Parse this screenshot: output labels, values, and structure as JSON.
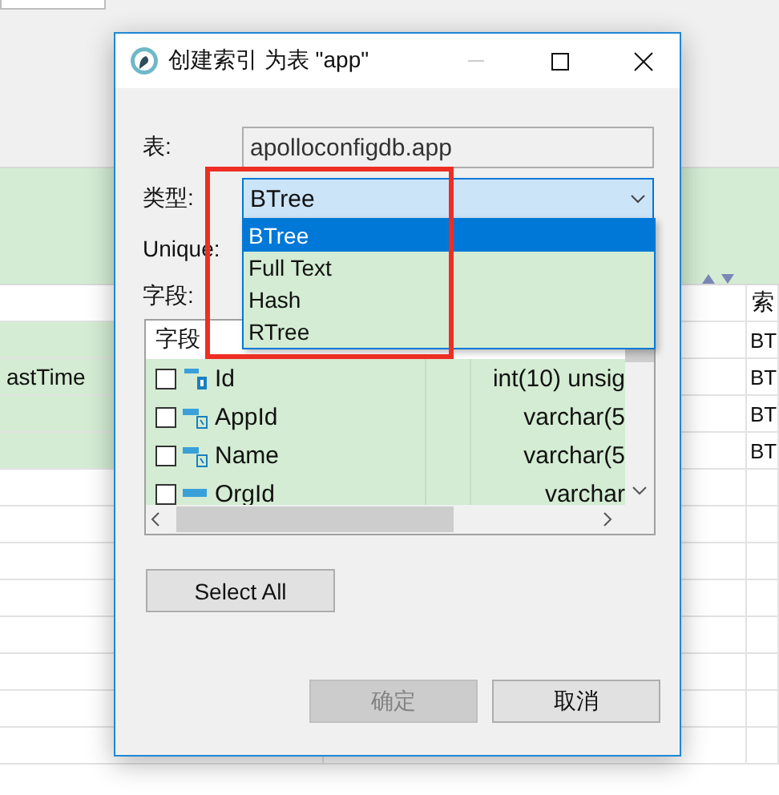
{
  "background_table": {
    "column_3_header": "索",
    "rows": [
      {
        "column_3": "BT"
      },
      {
        "column_1": "astTime",
        "column_3": "BT"
      },
      {
        "column_3": "BT"
      },
      {
        "column_3": "BT"
      }
    ]
  },
  "dialog": {
    "title": "创建索引 为表 \"app\"",
    "table_label": "表:",
    "table_value": "apolloconfigdb.app",
    "type_label": "类型:",
    "type_value": "BTree",
    "type_options": [
      {
        "label": "BTree",
        "selected": true
      },
      {
        "label": "Full Text",
        "selected": false
      },
      {
        "label": "Hash",
        "selected": false
      },
      {
        "label": "RTree",
        "selected": false
      }
    ],
    "unique_label": "Unique:",
    "fields_label": "字段:",
    "fields_header": "字段",
    "fields": [
      {
        "kind": "number_key",
        "name": "Id",
        "type": "int(10) unsig",
        "checked": false
      },
      {
        "kind": "text_key",
        "name": "AppId",
        "type": "varchar(5",
        "checked": false
      },
      {
        "kind": "text_key",
        "name": "Name",
        "type": "varchar(5",
        "checked": false
      },
      {
        "kind": "text",
        "name": "OrgId",
        "type": "varchar",
        "checked": false
      }
    ],
    "select_all": "Select All",
    "buttons": [
      {
        "label": "确定",
        "disabled": true
      },
      {
        "label": "取消",
        "disabled": false
      }
    ]
  }
}
